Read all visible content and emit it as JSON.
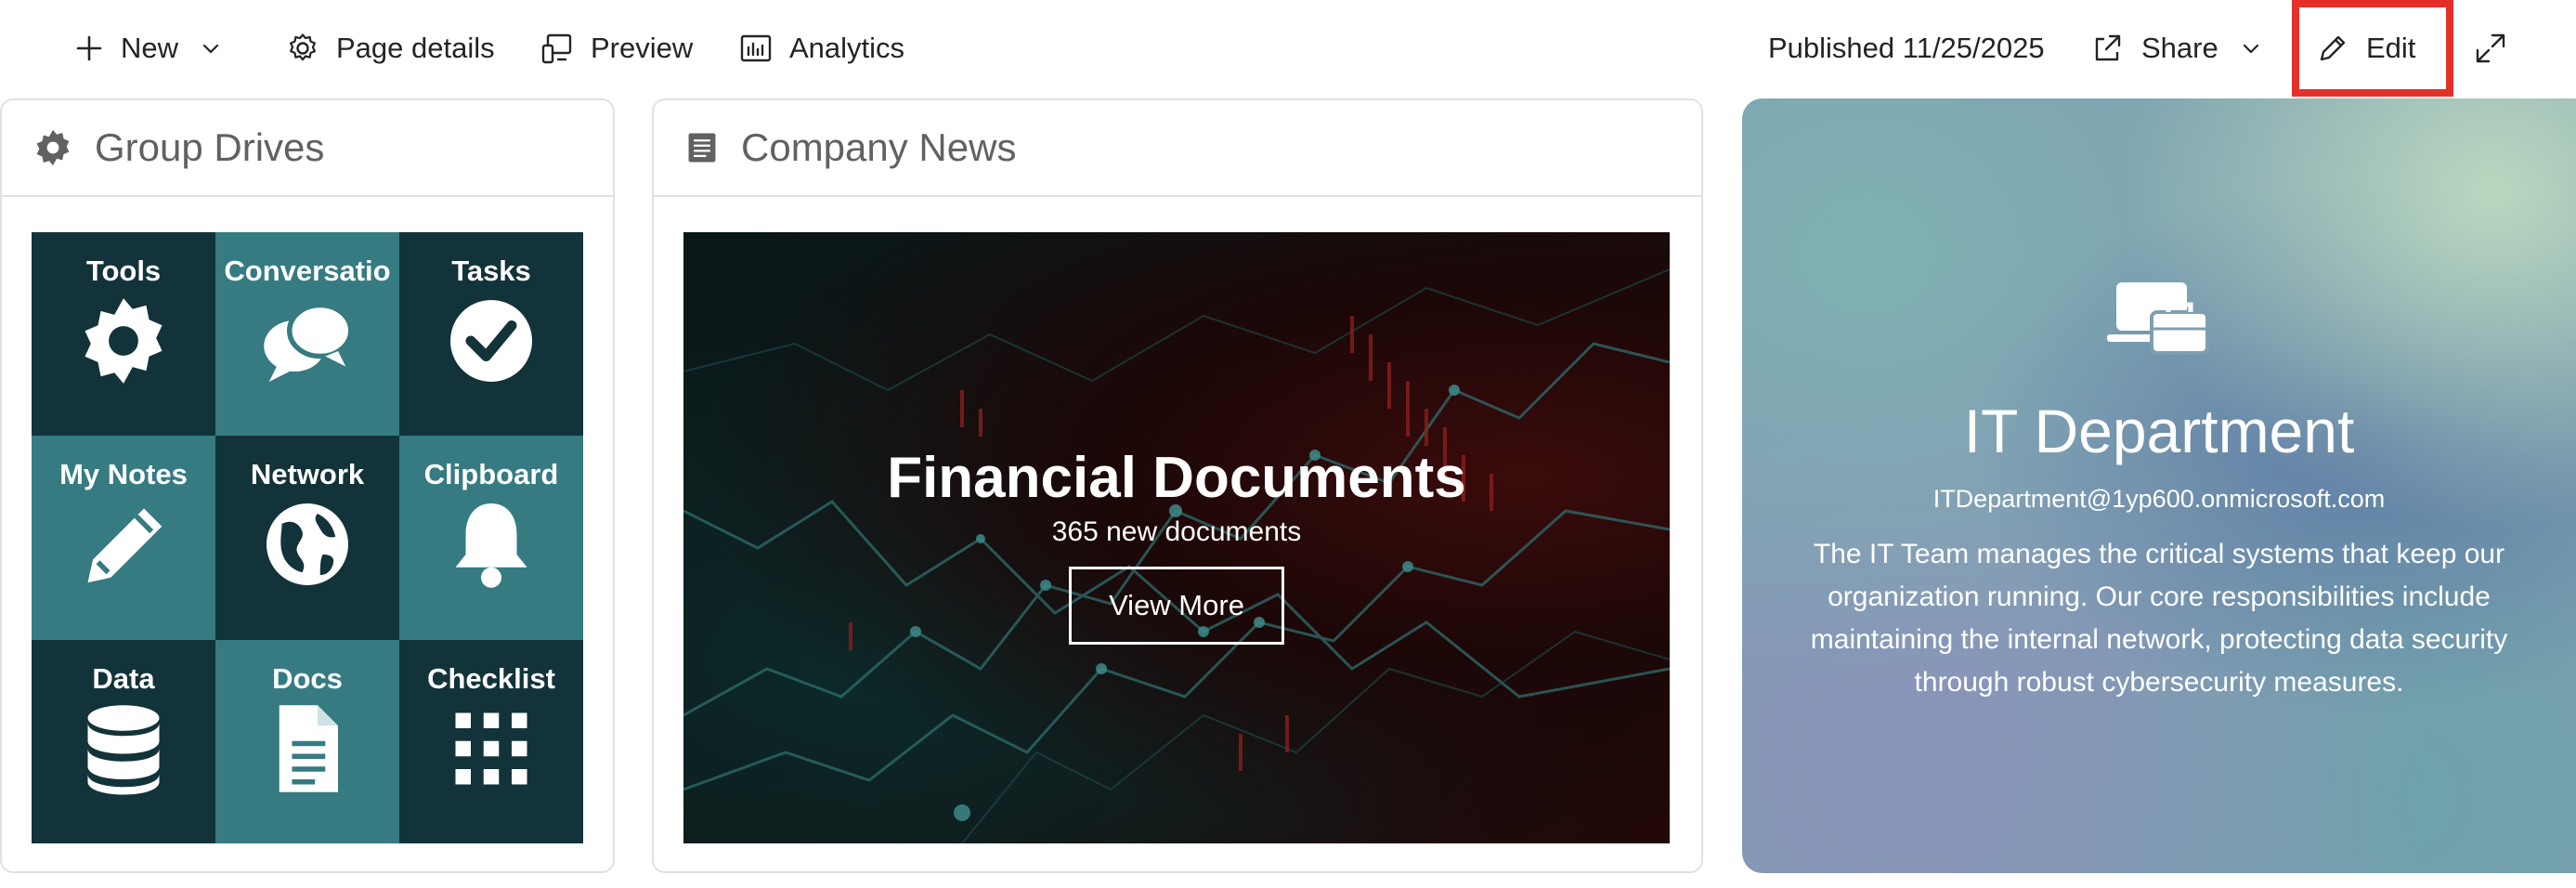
{
  "toolbar": {
    "new_label": "New",
    "page_details_label": "Page details",
    "preview_label": "Preview",
    "analytics_label": "Analytics",
    "published_label": "Published 11/25/2025",
    "share_label": "Share",
    "edit_label": "Edit"
  },
  "group_drives": {
    "title": "Group Drives",
    "tiles": [
      {
        "label": "Tools",
        "icon": "gear-icon",
        "style": "dark"
      },
      {
        "label": "Conversatio",
        "icon": "chat-bubbles-icon",
        "style": "teal"
      },
      {
        "label": "Tasks",
        "icon": "check-circle-icon",
        "style": "dark"
      },
      {
        "label": "My Notes",
        "icon": "pencil-icon",
        "style": "teal"
      },
      {
        "label": "Network",
        "icon": "globe-icon",
        "style": "dark"
      },
      {
        "label": "Clipboard",
        "icon": "bell-icon",
        "style": "teal"
      },
      {
        "label": "Data",
        "icon": "database-icon",
        "style": "dark"
      },
      {
        "label": "Docs",
        "icon": "document-icon",
        "style": "teal"
      },
      {
        "label": "Checklist",
        "icon": "grid-dots-icon",
        "style": "dark"
      }
    ]
  },
  "company_news": {
    "title": "Company News",
    "headline": "Financial Documents",
    "subtitle": "365 new documents",
    "button_label": "View More"
  },
  "it_department": {
    "title": "IT Department",
    "email": "ITDepartment@1yp600.onmicrosoft.com",
    "description": "The IT Team manages the critical systems that keep our organization running. Our core responsibilities include maintaining the internal network, protecting data security through robust cybersecurity measures."
  },
  "colors": {
    "tile_dark": "#13333a",
    "tile_teal": "#367b82",
    "highlight": "#e5302a"
  }
}
